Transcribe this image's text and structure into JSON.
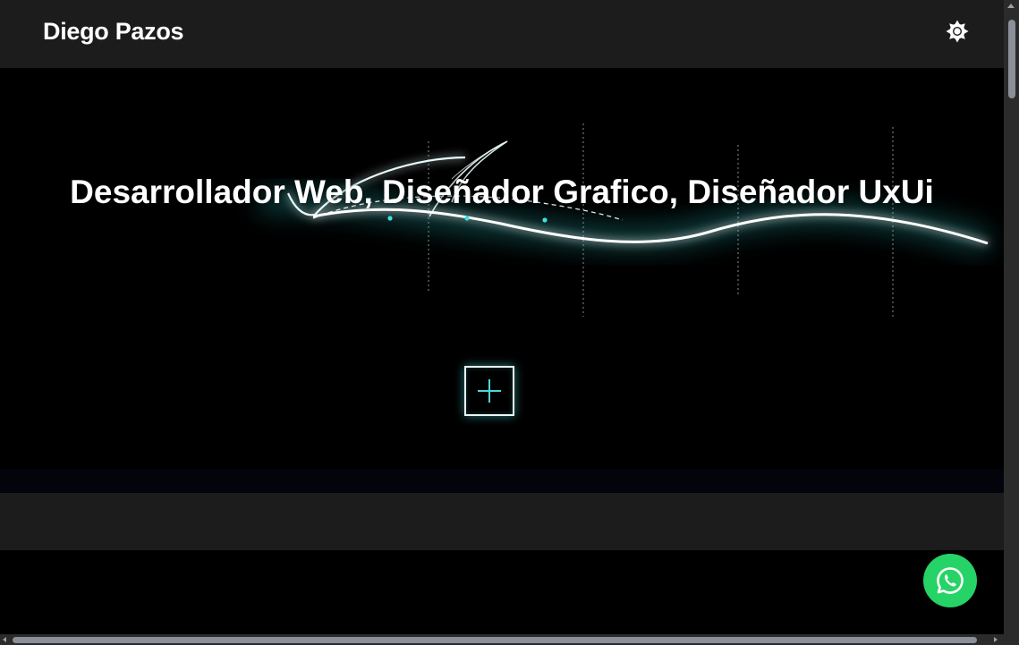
{
  "navbar": {
    "brand": "Diego Pazos",
    "theme_toggle_icon": "sun-icon"
  },
  "hero": {
    "title": "Desarrollador Web, Diseñador Grafico, Diseñador UxUi",
    "more_button_icon": "plus-icon",
    "accent_color": "#4fd6d6"
  },
  "floating": {
    "whatsapp_icon": "whatsapp-icon",
    "whatsapp_color": "#25d366"
  },
  "colors": {
    "navbar_bg": "#1c1c1c",
    "page_bg": "#000000"
  }
}
